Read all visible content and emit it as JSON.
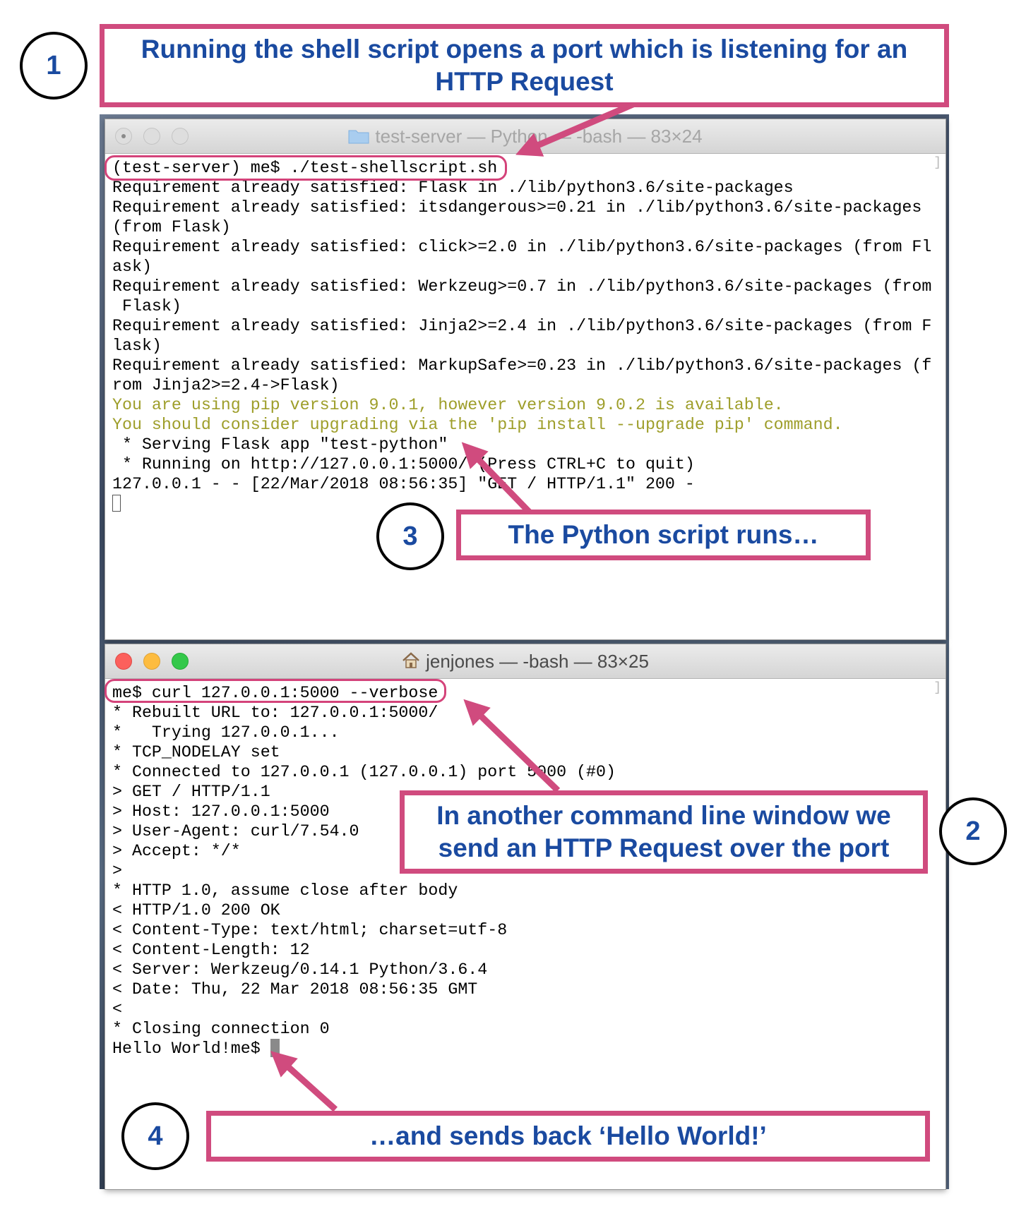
{
  "callouts": {
    "step1": {
      "number": "1",
      "text": "Running the shell script opens a port which is listening for an HTTP Request"
    },
    "step2": {
      "number": "2",
      "text": "In another command line window we send an HTTP Request over the port"
    },
    "step3": {
      "number": "3",
      "text": "The Python script runs…"
    },
    "step4": {
      "number": "4",
      "text": "…and sends back ‘Hello World!’"
    }
  },
  "window_server": {
    "title": "test-server — Python — -bash — 83×24",
    "title_icon": "folder-icon",
    "lines": [
      {
        "text": "(test-server) me$ ./test-shellscript.sh"
      },
      {
        "text": "Requirement already satisfied: Flask in ./lib/python3.6/site-packages"
      },
      {
        "text": "Requirement already satisfied: itsdangerous>=0.21 in ./lib/python3.6/site-packages"
      },
      {
        "text": "(from Flask)"
      },
      {
        "text": "Requirement already satisfied: click>=2.0 in ./lib/python3.6/site-packages (from Fl"
      },
      {
        "text": "ask)"
      },
      {
        "text": "Requirement already satisfied: Werkzeug>=0.7 in ./lib/python3.6/site-packages (from"
      },
      {
        "text": " Flask)"
      },
      {
        "text": "Requirement already satisfied: Jinja2>=2.4 in ./lib/python3.6/site-packages (from F"
      },
      {
        "text": "lask)"
      },
      {
        "text": "Requirement already satisfied: MarkupSafe>=0.23 in ./lib/python3.6/site-packages (f"
      },
      {
        "text": "rom Jinja2>=2.4->Flask)"
      },
      {
        "text": "You are using pip version 9.0.1, however version 9.0.2 is available.",
        "style": "warning"
      },
      {
        "text": "You should consider upgrading via the 'pip install --upgrade pip' command.",
        "style": "warning"
      },
      {
        "text": " * Serving Flask app \"test-python\""
      },
      {
        "text": " * Running on http://127.0.0.1:5000/ (Press CTRL+C to quit)"
      },
      {
        "text": "127.0.0.1 - - [22/Mar/2018 08:56:35] \"GET / HTTP/1.1\" 200 -"
      },
      {
        "text": "",
        "cursor": "empty"
      }
    ]
  },
  "window_client": {
    "title": "jenjones — -bash — 83×25",
    "title_icon": "home-icon",
    "lines": [
      {
        "text": "me$ curl 127.0.0.1:5000 --verbose"
      },
      {
        "text": "* Rebuilt URL to: 127.0.0.1:5000/"
      },
      {
        "text": "*   Trying 127.0.0.1..."
      },
      {
        "text": "* TCP_NODELAY set"
      },
      {
        "text": "* Connected to 127.0.0.1 (127.0.0.1) port 5000 (#0)"
      },
      {
        "text": "> GET / HTTP/1.1"
      },
      {
        "text": "> Host: 127.0.0.1:5000"
      },
      {
        "text": "> User-Agent: curl/7.54.0"
      },
      {
        "text": "> Accept: */*"
      },
      {
        "text": ">"
      },
      {
        "text": "* HTTP 1.0, assume close after body"
      },
      {
        "text": "< HTTP/1.0 200 OK"
      },
      {
        "text": "< Content-Type: text/html; charset=utf-8"
      },
      {
        "text": "< Content-Length: 12"
      },
      {
        "text": "< Server: Werkzeug/0.14.1 Python/3.6.4"
      },
      {
        "text": "< Date: Thu, 22 Mar 2018 08:56:35 GMT"
      },
      {
        "text": "<"
      },
      {
        "text": "* Closing connection 0"
      },
      {
        "text": "Hello World!me$ ",
        "cursor": "block"
      }
    ]
  },
  "colors": {
    "callout_border": "#d04b7e",
    "callout_text": "#1a4aa0",
    "highlight": "#d4437a",
    "warning_text": "#9e9e2a"
  }
}
